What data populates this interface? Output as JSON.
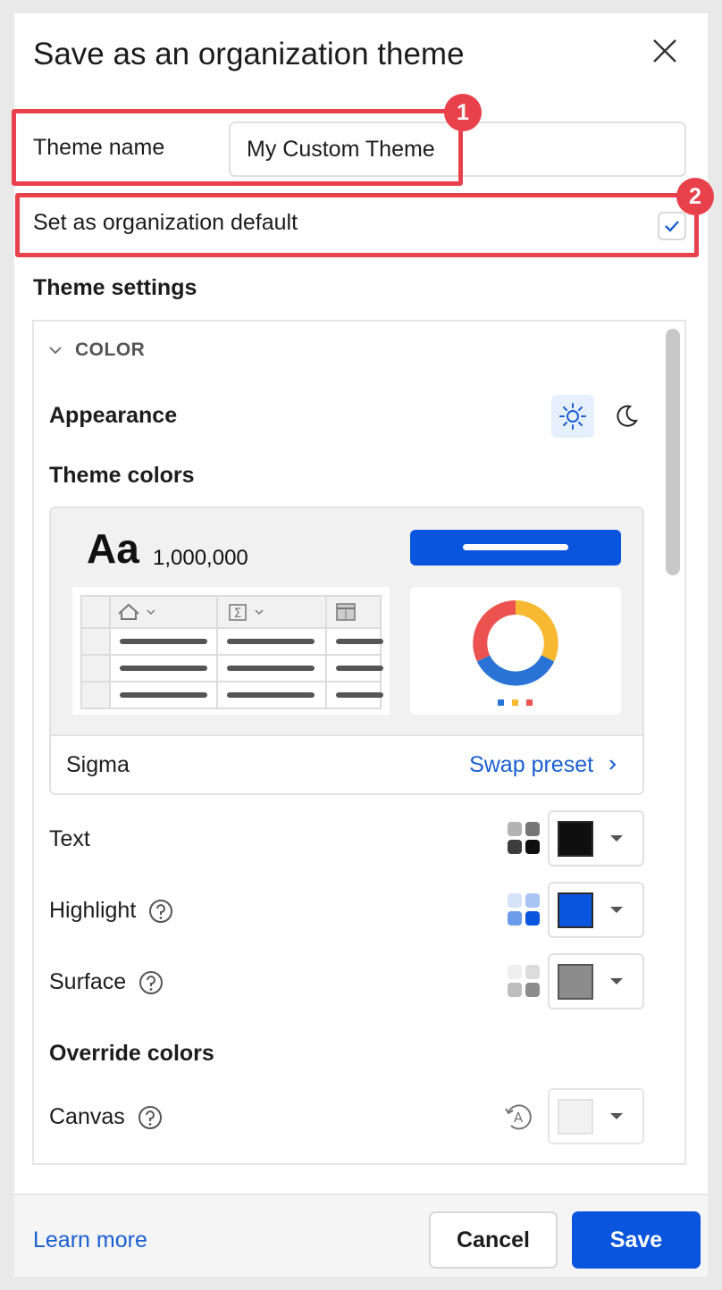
{
  "dialog": {
    "title": "Save as an organization theme",
    "close_icon": "close-icon"
  },
  "form": {
    "theme_name_label": "Theme name",
    "theme_name_value": "My Custom Theme",
    "org_default_label": "Set as organization default",
    "org_default_checked": true
  },
  "annotations": [
    {
      "label": "1",
      "color": "#e8414c"
    },
    {
      "label": "2",
      "color": "#e8414c"
    }
  ],
  "settings": {
    "title": "Theme settings",
    "color_section": {
      "header": "COLOR",
      "appearance_label": "Appearance",
      "appearance_modes": [
        "sun-icon",
        "moon-icon"
      ],
      "appearance_selected": "light",
      "theme_colors_label": "Theme colors",
      "preview": {
        "sample_text": "Aa",
        "sample_number": "1,000,000",
        "button_color": "#0a55de",
        "donut_colors": [
          "#f7b832",
          "#2a73d6",
          "#ec5350"
        ],
        "legend_colors": [
          "#2a73d6",
          "#f7b832",
          "#ec5350"
        ]
      },
      "preset_name": "Sigma",
      "swap_preset_label": "Swap preset",
      "colors": [
        {
          "label": "Text",
          "help": false,
          "swatch": "#0f0f0f",
          "palette": [
            "#b3b3b3",
            "#777777",
            "#3d3d3d",
            "#0f0f0f"
          ]
        },
        {
          "label": "Highlight",
          "help": true,
          "swatch": "#0a55de",
          "palette": [
            "#d5e2f8",
            "#a9c4f2",
            "#6b9bea",
            "#0a55de"
          ]
        },
        {
          "label": "Surface",
          "help": true,
          "swatch": "#8c8c8c",
          "palette": [
            "#eeeeee",
            "#dcdcdc",
            "#bdbdbd",
            "#8c8c8c"
          ]
        }
      ],
      "override_label": "Override colors",
      "overrides": [
        {
          "label": "Canvas",
          "help": true,
          "swatch": "#f1f1f1",
          "icon": "auto-color-icon"
        }
      ]
    }
  },
  "footer": {
    "learn_more": "Learn more",
    "cancel": "Cancel",
    "save": "Save"
  }
}
